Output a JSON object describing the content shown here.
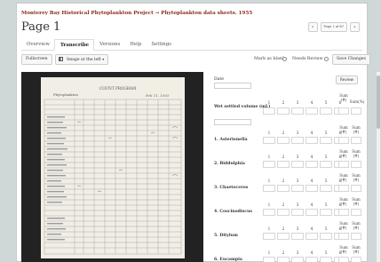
{
  "header": {
    "breadcrumb": "Monterey Bay Historical Phytoplankton Project → Phytoplankton data sheets. 1955",
    "page_title": "Page 1",
    "pager_label": "Page 1 of 87",
    "prev_icon": "chevron-left-icon",
    "next_icon": "chevron-right-icon"
  },
  "tabs": [
    {
      "label": "Overview"
    },
    {
      "label": "Transcribe"
    },
    {
      "label": "Versions"
    },
    {
      "label": "Help"
    },
    {
      "label": "Settings"
    }
  ],
  "toolbar": {
    "fullscreen_label": "Fullscreen",
    "layout_label": "Image at the left",
    "layout_icon": "layout-icon",
    "mark_blank_label": "Mark as blank",
    "needs_review_label": "Needs Review",
    "save_label": "Save Changes"
  },
  "form": {
    "review_label": "Review",
    "date_label": "Date",
    "wet_settled_label": "Wet settled volume (mL)",
    "column_numbers": [
      "1",
      "2",
      "3",
      "4",
      "5",
      "6"
    ],
    "sum_label": "Sum (#)",
    "sum_pct_label": "Sum(%)",
    "species": [
      {
        "label": "1. Asterionella"
      },
      {
        "label": "2. Biddulphia"
      },
      {
        "label": "3. Chaetoceros"
      },
      {
        "label": "4. Coscinodiscus"
      },
      {
        "label": "5. Ditylum"
      },
      {
        "label": "6. Eucampia"
      }
    ]
  },
  "sheet": {
    "header_text": "COUNT PROGRAM",
    "subheader_text": "Phytoplankton",
    "handwritten_date": "Feb 11, 1955"
  },
  "colors": {
    "brand": "#8a2a1c",
    "background": "#cfd8d6",
    "sheet_dark": "#222222",
    "paper": "#f1eee6"
  }
}
